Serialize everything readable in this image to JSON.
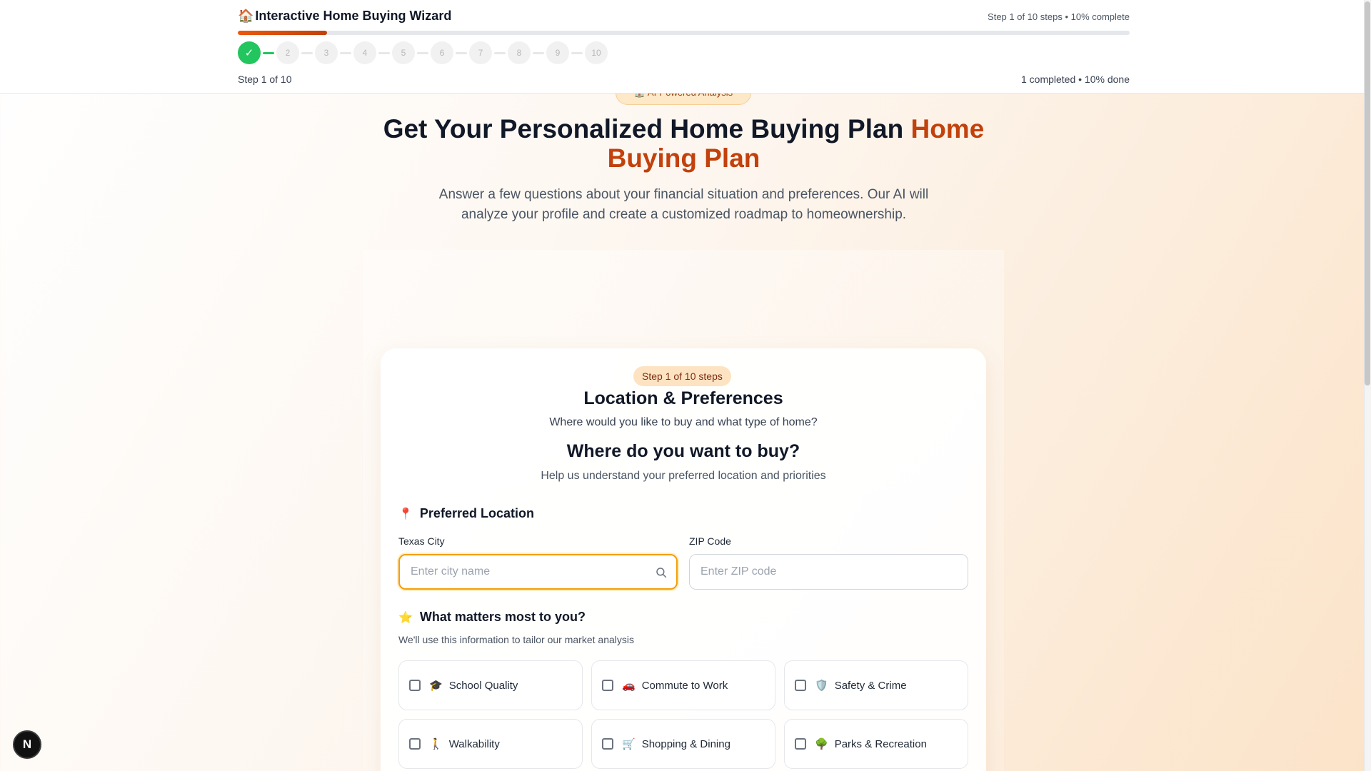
{
  "header": {
    "app_icon": "🏠",
    "app_title": "Interactive Home Buying Wizard",
    "top_status": "Step 1 of 10 steps • 10% complete",
    "progress_fraction": 0.1,
    "steps": [
      {
        "label": "✓",
        "state": "done"
      },
      {
        "label": "2",
        "state": "pending"
      },
      {
        "label": "3",
        "state": "pending"
      },
      {
        "label": "4",
        "state": "pending"
      },
      {
        "label": "5",
        "state": "pending"
      },
      {
        "label": "6",
        "state": "pending"
      },
      {
        "label": "7",
        "state": "pending"
      },
      {
        "label": "8",
        "state": "pending"
      },
      {
        "label": "9",
        "state": "pending"
      },
      {
        "label": "10",
        "state": "pending"
      }
    ],
    "step_label": "Step 1 of 10",
    "step_summary": "1 completed • 10% done"
  },
  "hero": {
    "badge": "🏠 AI-Powered Analysis",
    "title_main": "Get Your Personalized Home Buying Plan ",
    "title_accent": "Home Buying Plan",
    "subtitle": "Answer a few questions about your financial situation and preferences. Our AI will analyze your profile and create a customized roadmap to homeownership."
  },
  "card": {
    "badge": "Step 1 of 10 steps",
    "title": "Location & Preferences",
    "subtitle": "Where would you like to buy and what type of home?",
    "section_title": "Where do you want to buy?",
    "section_subtitle": "Help us understand your preferred location and priorities",
    "location": {
      "icon": "📍",
      "heading": "Preferred Location",
      "city_label": "Texas City",
      "city_placeholder": "Enter city name",
      "city_value": "",
      "zip_label": "ZIP Code",
      "zip_placeholder": "Enter ZIP code",
      "zip_value": ""
    },
    "matters": {
      "icon": "⭐",
      "heading": "What matters most to you?",
      "note": "We'll use this information to tailor our market analysis",
      "options": [
        {
          "icon": "🎓",
          "label": "School Quality",
          "checked": false
        },
        {
          "icon": "🚗",
          "label": "Commute to Work",
          "checked": false
        },
        {
          "icon": "🛡️",
          "label": "Safety & Crime",
          "checked": false
        },
        {
          "icon": "🚶",
          "label": "Walkability",
          "checked": false
        },
        {
          "icon": "🛒",
          "label": "Shopping & Dining",
          "checked": false
        },
        {
          "icon": "🌳",
          "label": "Parks & Recreation",
          "checked": false
        }
      ]
    }
  },
  "dev_badge": "N",
  "colors": {
    "accent": "#c2410c",
    "success": "#22c55e",
    "focus_border": "#f59e0b"
  }
}
